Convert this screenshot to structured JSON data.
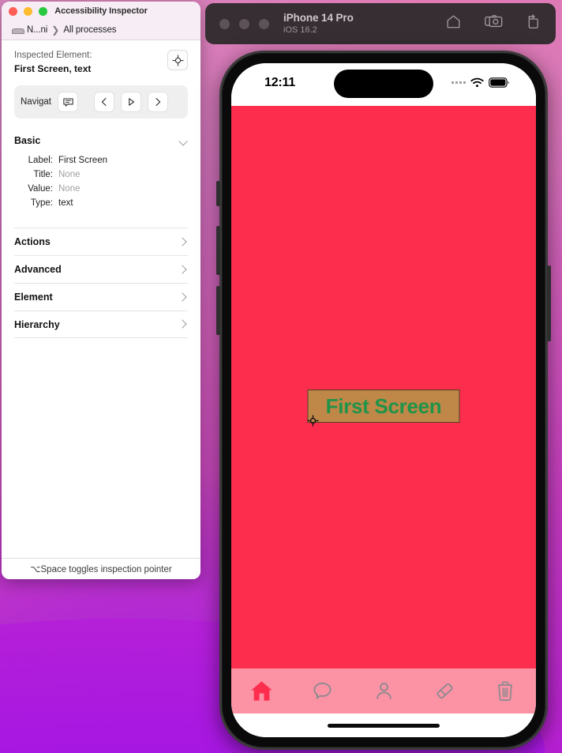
{
  "inspector": {
    "window_title": "Accessibility Inspector",
    "path": {
      "device_icon": "mac-laptop-icon",
      "device_label": "N...ni",
      "separator": "❯",
      "scope_label": "All processes"
    },
    "inspected": {
      "caption": "Inspected Element:",
      "value": "First Screen, text",
      "target_button_icon": "crosshair-target-icon"
    },
    "navigation": {
      "label": "Navigat",
      "buttons": [
        {
          "name": "speech-bubble-button",
          "icon": "speech-bubble-icon"
        },
        {
          "name": "nav-back-button",
          "icon": "chevron-left-icon"
        },
        {
          "name": "nav-play-button",
          "icon": "play-triangle-icon"
        },
        {
          "name": "nav-forward-button",
          "icon": "chevron-right-icon"
        }
      ]
    },
    "basic": {
      "title": "Basic",
      "rows": [
        {
          "key": "Label:",
          "value": "First Screen",
          "muted": false
        },
        {
          "key": "Title:",
          "value": "None",
          "muted": true
        },
        {
          "key": "Value:",
          "value": "None",
          "muted": true
        },
        {
          "key": "Type:",
          "value": "text",
          "muted": false
        }
      ]
    },
    "sections": [
      {
        "title": "Actions"
      },
      {
        "title": "Advanced"
      },
      {
        "title": "Element"
      },
      {
        "title": "Hierarchy"
      }
    ],
    "status_hint": "⌥Space toggles inspection pointer"
  },
  "simulator": {
    "device_name": "iPhone 14 Pro",
    "os_version": "iOS 16.2",
    "window_dots": 3,
    "actions": [
      {
        "name": "home-button",
        "icon": "home-icon"
      },
      {
        "name": "screenshot-button",
        "icon": "camera-icon"
      },
      {
        "name": "rotate-button",
        "icon": "rotate-icon"
      }
    ],
    "ios_status": {
      "time": "12:11",
      "cellular_icon": "signal-dots-icon",
      "wifi_icon": "wifi-icon",
      "battery_icon": "battery-full-icon"
    },
    "app": {
      "background_color": "#fd2d4e",
      "screen_text": "First Screen",
      "screen_text_color": "#219349",
      "highlight_color": "#ada046",
      "highlight_border_color": "#4d4422",
      "cursor_icon": "crosshair-cursor-icon"
    },
    "tab_bar": {
      "background_color": "#fc93a4",
      "active_color": "#fd2d4e",
      "inactive_color": "#8a8a8f",
      "items": [
        {
          "name": "tab-home",
          "icon": "home-icon",
          "active": true
        },
        {
          "name": "tab-chat",
          "icon": "chat-bubble-icon",
          "active": false
        },
        {
          "name": "tab-profile",
          "icon": "person-icon",
          "active": false
        },
        {
          "name": "tab-eraser",
          "icon": "eraser-icon",
          "active": false
        },
        {
          "name": "tab-trash",
          "icon": "trash-icon",
          "active": false
        }
      ]
    }
  }
}
